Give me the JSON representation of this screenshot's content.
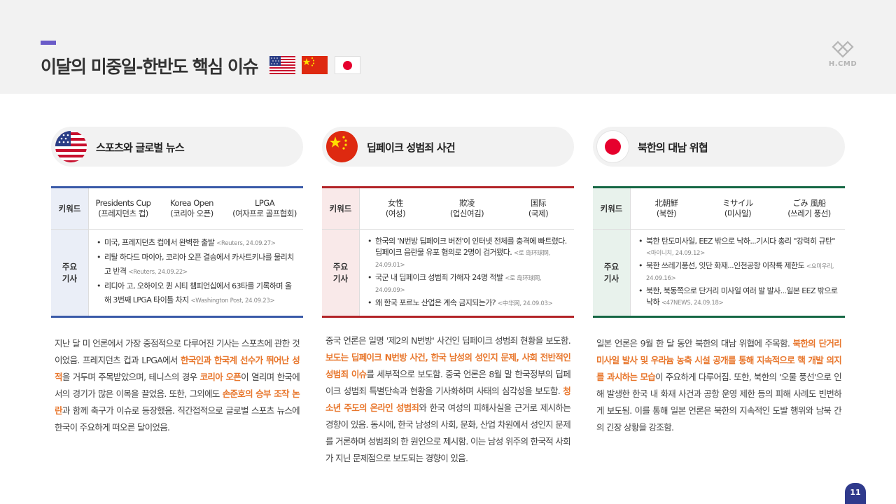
{
  "header": {
    "title": "이달의 미중일-한반도 핵심 이슈",
    "logo_text": "H.CMD",
    "accent_color": "#6a5cc8"
  },
  "columns": [
    {
      "id": "us",
      "country_icon": "us-flag-icon",
      "title": "스포츠와 글로벌 뉴스",
      "accent_color": "#3a5aa8",
      "keyword_label": "키워드",
      "keywords": [
        {
          "main": "Presidents Cup",
          "sub": "(프레지던츠 컵)"
        },
        {
          "main": "Korea Open",
          "sub": "(코리아 오픈)"
        },
        {
          "main": "LPGA",
          "sub": "(여자프로 골프협회)"
        }
      ],
      "articles_label": "주요 기사",
      "articles": [
        {
          "text": "미국, 프레지던츠 컵에서 완벽한 출발",
          "source": "<Reuters, 24.09.27>"
        },
        {
          "text": "리탈 하다드 마이아, 코리아 오픈 결승에서 카사트키나를 물리치고 반격",
          "source": "<Reuters, 24.09.22>"
        },
        {
          "text": "리디아 고, 오하이오 퀸 시티 챔피언십에서 63타를 기록하며 올해 3번째 LPGA 타이틀 차지",
          "source": "<Washington Post, 24.09.23>"
        }
      ],
      "summary": [
        {
          "t": "지난 달 미 언론에서 가장 중점적으로 다루어진 기사는 스포츠에 관한 것이었음. 프레지던츠 컵과 LPGA에서 "
        },
        {
          "t": "한국인과 한국계 선수가 뛰어난 성적",
          "hl": true
        },
        {
          "t": "을 거두며 주목받았으며, 테니스의 경우 "
        },
        {
          "t": "코리아 오픈",
          "hl": true
        },
        {
          "t": "이 열리며 한국에서의 경기가 많은 이목을 끌었음. 또한, 그외에도 "
        },
        {
          "t": "손준호의 승부 조작 논란",
          "hl": true
        },
        {
          "t": "과 함께 축구가 이슈로 등장했음. 직간접적으로 글로벌 스포츠 뉴스에 한국이 주요하게 떠오른 달이었음."
        }
      ]
    },
    {
      "id": "cn",
      "country_icon": "china-flag-icon",
      "title": "딥페이크 성범죄 사건",
      "accent_color": "#b32428",
      "keyword_label": "키워드",
      "keywords": [
        {
          "main": "女性",
          "sub": "(여성)"
        },
        {
          "main": "欺凌",
          "sub": "(업신여김)"
        },
        {
          "main": "国际",
          "sub": "(국제)"
        }
      ],
      "articles_label": "주요 기사",
      "articles": [
        {
          "text": "한국의 'N번방 딥페이크 버전'이 인터넷 전체를 충격에 빠트렸다. 딥페이크 음란물 유포 혐의로 2명이 검거됐다.",
          "source": "<로 岛环球网, 24.09.01>"
        },
        {
          "text": "국군 내 딥페이크 성범죄 가해자 24명 적발",
          "source": "<로 岛环球网, 24.09.09>"
        },
        {
          "text": "왜 한국 포르노 산업은 계속 금지되는가?",
          "source": "<中华网, 24.09.03>"
        }
      ],
      "summary": [
        {
          "t": "중국 언론은 일명 '제2의 N번방' 사건인 딥페이크 성범죄 현황을 보도함. "
        },
        {
          "t": "보도는 딥페이크 N번방 사건, 한국 남성의 성인지 문제, 사회 전반적인 성범죄 이슈",
          "hl": true
        },
        {
          "t": "를 세부적으로 보도함. 중국 언론은 8월 말 한국정부의 딥페이크 성범죄 특별단속과 현황을 기사화하며 사태의 심각성을 보도함. "
        },
        {
          "t": "청소년 주도의 온라인 성범죄",
          "hl": true
        },
        {
          "t": "와 한국 여성의 피해사실을 근거로 제시하는 경향이 있음. 동시에, 한국 남성의 사회, 문화, 산업 차원에서 성인지 문제를 거론하며 성범죄의 한 원인으로 제시함. 이는 남성 위주의 한국적 사회가 지닌 문제점으로 보도되는 경향이 있음."
        }
      ]
    },
    {
      "id": "jp",
      "country_icon": "japan-flag-icon",
      "title": "북한의 대남 위협",
      "accent_color": "#166845",
      "keyword_label": "키워드",
      "keywords": [
        {
          "main": "北朝鮮",
          "sub": "(북한)"
        },
        {
          "main": "ミサイル",
          "sub": "(미사일)"
        },
        {
          "main": "ごみ 風船",
          "sub": "(쓰레기 풍선)"
        }
      ],
      "articles_label": "주요 기사",
      "articles": [
        {
          "text": "북한 탄도미사일, EEZ 밖으로 낙하...기시다 총리 \"강력히 규탄\"",
          "source": "<마이니치, 24.09.12>"
        },
        {
          "text": "북한 쓰레기풍선, 잇단 화재...인천공항 이착륙 제한도",
          "source": "<요미우리, 24.09.16>"
        },
        {
          "text": "북한, 북동쪽으로 단거리 미사일 여러 발 발사...일본 EEZ 밖으로 낙하",
          "source": "<47NEWS, 24.09.18>"
        }
      ],
      "summary": [
        {
          "t": "일본 언론은 9월 한 달 동안 북한의 대남 위협에 주목함. "
        },
        {
          "t": "북한의 단거리 미사일 발사 및 우라늄 농축 시설 공개를 통해 지속적으로 핵 개발 의지를 과시하는 모습",
          "hl": true
        },
        {
          "t": "이 주요하게 다루어짐. 또한, 북한의 '오물 풍선'으로 인해 발생한 한국 내 화재 사건과 공항 운영 제한 등의 피해 사례도 빈번하게 보도됨. 이를 통해 일본 언론은 북한의 지속적인 도발 행위와 남북 간의 긴장 상황을 강조함."
        }
      ]
    }
  ],
  "footer": {
    "page_number": "11"
  }
}
